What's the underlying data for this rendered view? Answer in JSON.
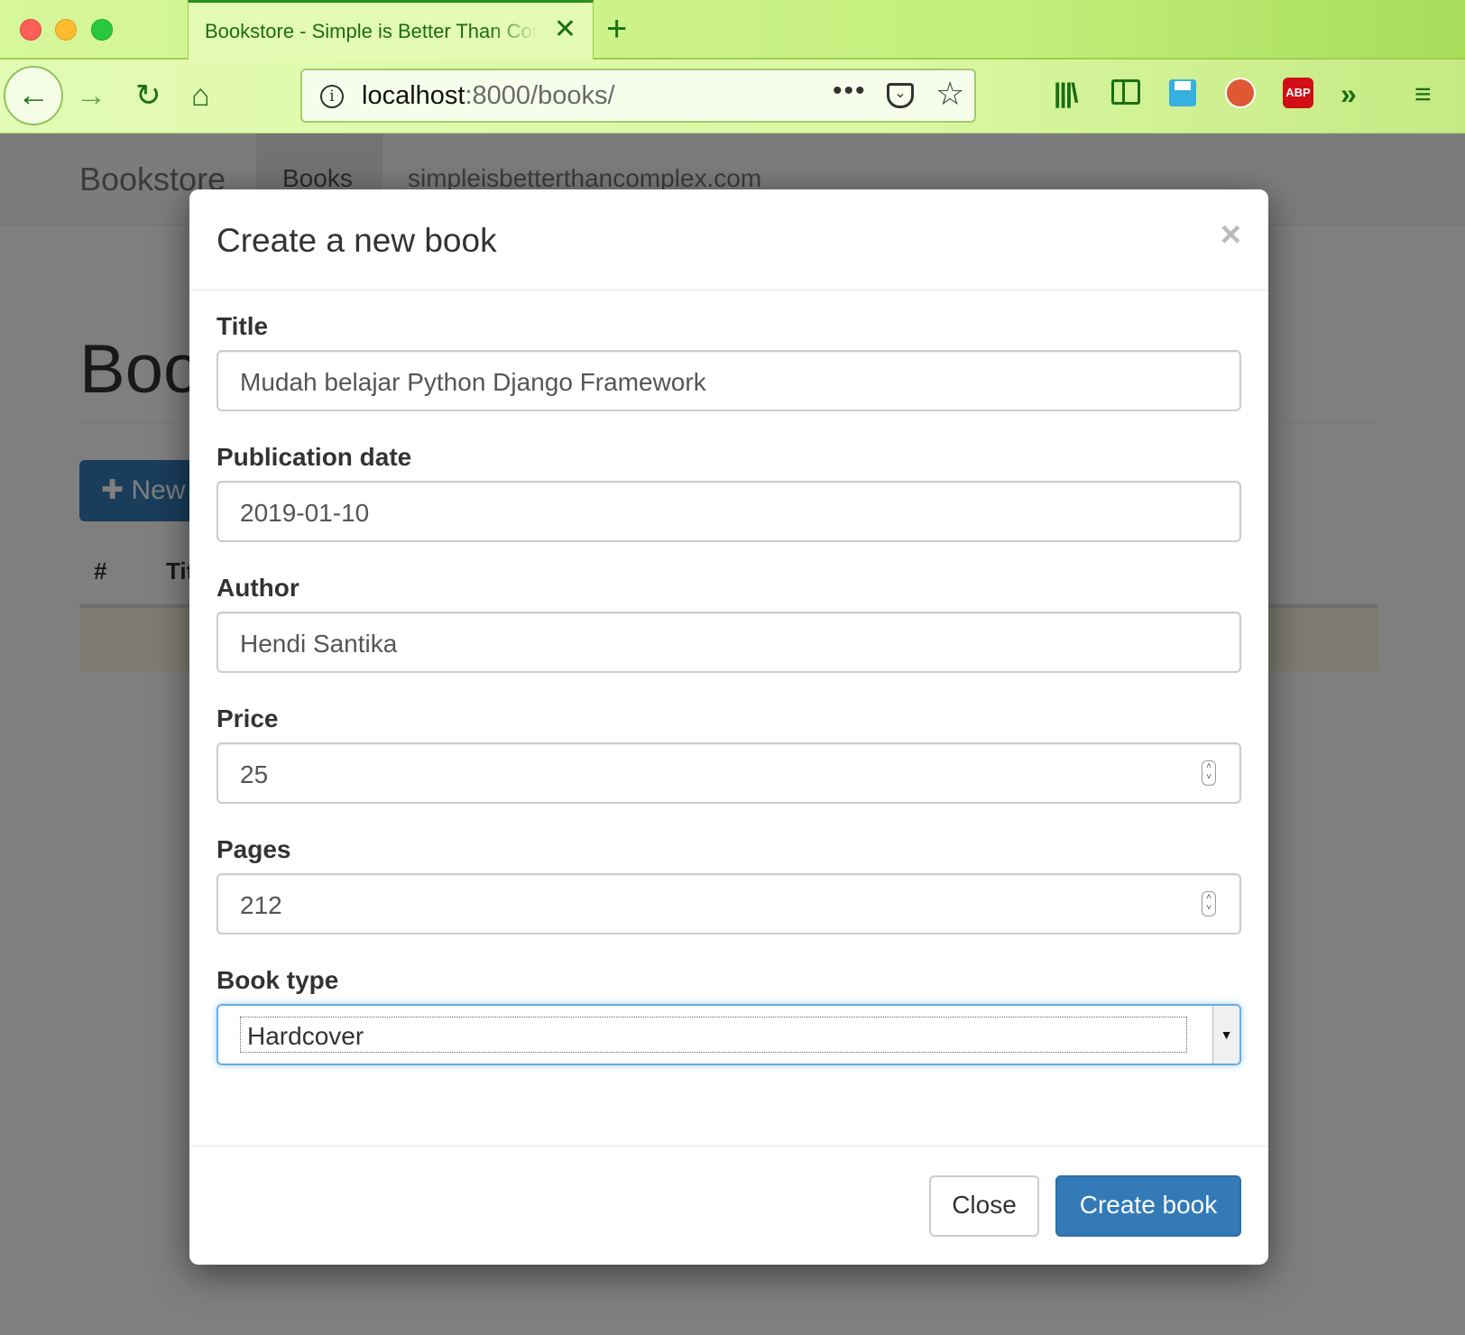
{
  "browser": {
    "tab_title": "Bookstore - Simple is Better Than Complex",
    "new_tab_icon": "plus-icon",
    "url_host": "localhost",
    "url_rest": ":8000/books/",
    "toolbar_icons": [
      "back-icon",
      "forward-icon",
      "reload-icon",
      "home-icon",
      "info-icon",
      "more-icon",
      "pocket-icon",
      "star-icon",
      "library-icon",
      "sidebar-icon",
      "save-icon",
      "duckduckgo-icon",
      "adblock-icon",
      "overflow-icon",
      "menu-icon"
    ],
    "adblock_label": "ABP"
  },
  "site": {
    "brand": "Bookstore",
    "nav_books": "Books",
    "nav_external": "simpleisbetterthancomplex.com",
    "heading": "Books",
    "new_button": "New book",
    "table_headers": [
      "#",
      "Title"
    ]
  },
  "modal": {
    "title": "Create a new book",
    "close_symbol": "×",
    "fields": [
      {
        "label": "Title",
        "value": "Mudah belajar Python Django Framework"
      },
      {
        "label": "Publication date",
        "value": "2019-01-10"
      },
      {
        "label": "Author",
        "value": "Hendi Santika"
      },
      {
        "label": "Price",
        "value": "25"
      },
      {
        "label": "Pages",
        "value": "212"
      },
      {
        "label": "Book type",
        "value": "Hardcover"
      }
    ],
    "close_button": "Close",
    "submit_button": "Create book"
  },
  "colors": {
    "primary": "#337ab7",
    "browser_theme": "#cdf38a",
    "browser_accent": "#1b6e12"
  }
}
